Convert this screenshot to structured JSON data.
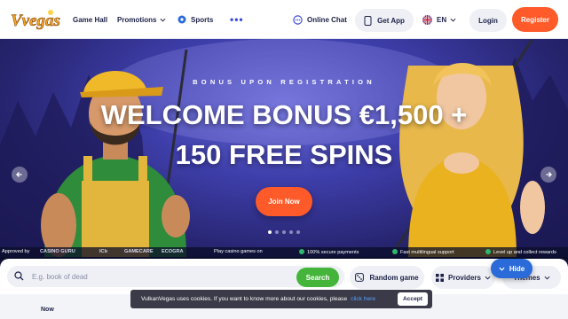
{
  "header": {
    "logo_text": "Vvegas",
    "nav": {
      "game_hall": "Game Hall",
      "promotions": "Promotions",
      "sports": "Sports",
      "more": "•••",
      "online_chat": "Online Chat"
    },
    "get_app": "Get App",
    "language": "EN",
    "login": "Login",
    "register": "Register"
  },
  "hero": {
    "kicker": "BONUS UPON REGISTRATION",
    "title_line1": "WELCOME BONUS €1,500 +",
    "title_line2": "150 FREE SPINS",
    "cta": "Join Now",
    "slides_total": 5,
    "active_slide": 1
  },
  "trust": {
    "approved": "Approved by",
    "casino_guru": "CASINO GURU",
    "logo2": "ICb",
    "logo3": "GAMECARE",
    "logo4": "ECOGRA",
    "play_games": "Play casino games on",
    "secure": "100% secure payments",
    "fast_support": "Fast multilingual support",
    "level_up": "Level up and collect rewards"
  },
  "search": {
    "placeholder": "E.g. book of dead",
    "search_button": "Search",
    "random_game": "Random game",
    "providers": "Providers",
    "themes": "Themes",
    "hide": "Hide"
  },
  "below": {
    "partial_text": "Now"
  },
  "cookie": {
    "message": "VulkanVegas uses cookies. If you want to know more about our cookies, please",
    "link": "click here",
    "accept": "Accept"
  },
  "colors": {
    "accent_orange": "#ff5a29",
    "accent_green": "#44b53a",
    "accent_blue": "#2a6bd9",
    "nav_text": "#1d2146"
  }
}
